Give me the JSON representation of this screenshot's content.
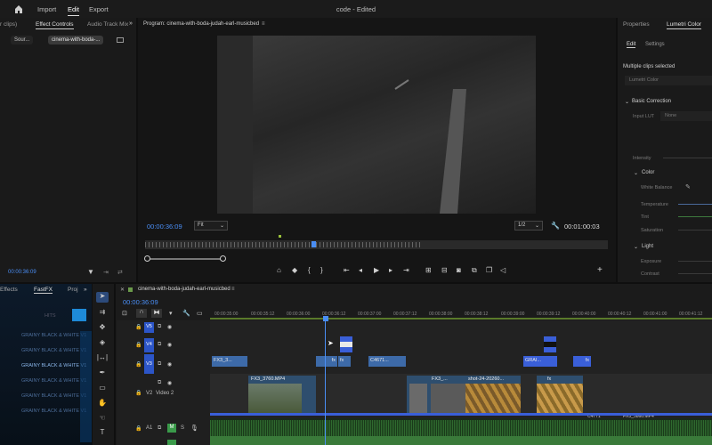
{
  "menu": {
    "import": "Import",
    "edit": "Edit",
    "export": "Export",
    "title": "code - Edited"
  },
  "left_panel": {
    "clips_tab": "r clips)",
    "tabs": [
      "Effect Controls",
      "Audio Track Mix"
    ],
    "source_pill": "Sour...",
    "sequence_pill": "cinema-with-boda-...",
    "timecode": "00:00:36:09"
  },
  "program": {
    "title": "Program: cinema-with-boda-judah-earl-musicbed",
    "timecode": "00:00:36:09",
    "fit": "Fit",
    "fraction": "1/2",
    "duration": "00:01:00:03"
  },
  "right_panel": {
    "tabs": [
      "Properties",
      "Lumetri Color"
    ],
    "subtabs": [
      "Edit",
      "Settings"
    ],
    "multi": "Multiple clips selected",
    "lumetri": "Lumetri Color",
    "basic": "Basic Correction",
    "input_lut_label": "Input LUT",
    "input_lut_value": "None",
    "intensity": "Intensity",
    "color": "Color",
    "wb": "White Balance",
    "temp": "Temperature",
    "tint": "Tint",
    "sat": "Saturation",
    "light": "Light",
    "exposure": "Exposure",
    "contrast": "Contrast"
  },
  "effects_panel": {
    "tabs": [
      "Effects",
      "FastFX",
      "Proj"
    ],
    "hits": "HITS",
    "items": [
      "GRAINY BLACK & WHITE V1",
      "GRAINY BLACK & WHITE V1",
      "GRAINY BLACK & WHITE V1",
      "GRAINY BLACK & WHITE V1",
      "GRAINY BLACK & WHITE V1",
      "GRAINY BLACK & WHITE V1"
    ]
  },
  "timeline": {
    "tab": "cinema-with-boda-judah-earl-musicbed",
    "timecode": "00:00:36:09",
    "ruler": [
      "00:00:35:00",
      "00:00:35:12",
      "00:00:36:00",
      "00:00:36:12",
      "00:00:37:00",
      "00:00:37:12",
      "00:00:38:00",
      "00:00:38:12",
      "00:00:39:00",
      "00:00:39:12",
      "00:00:40:00",
      "00:00:40:12",
      "00:00:41:00",
      "00:00:41:12"
    ],
    "tracks": {
      "v5": "V5",
      "v4": "V4",
      "v3": "V3",
      "v2": "V2",
      "v2_name": "Video 2",
      "a1": "A1",
      "m": "M",
      "s": "S"
    },
    "clips": {
      "c1": "FX3_3...",
      "c2": "fx",
      "c3": "C4671...",
      "c4": "GRAI...",
      "c5": "FX3_3760.MP4",
      "c6": "FX3_...",
      "c7": "shot-24-20260...",
      "c8": "C4771",
      "c9": "FX3_3860.MP4",
      "fx": "fx"
    }
  }
}
